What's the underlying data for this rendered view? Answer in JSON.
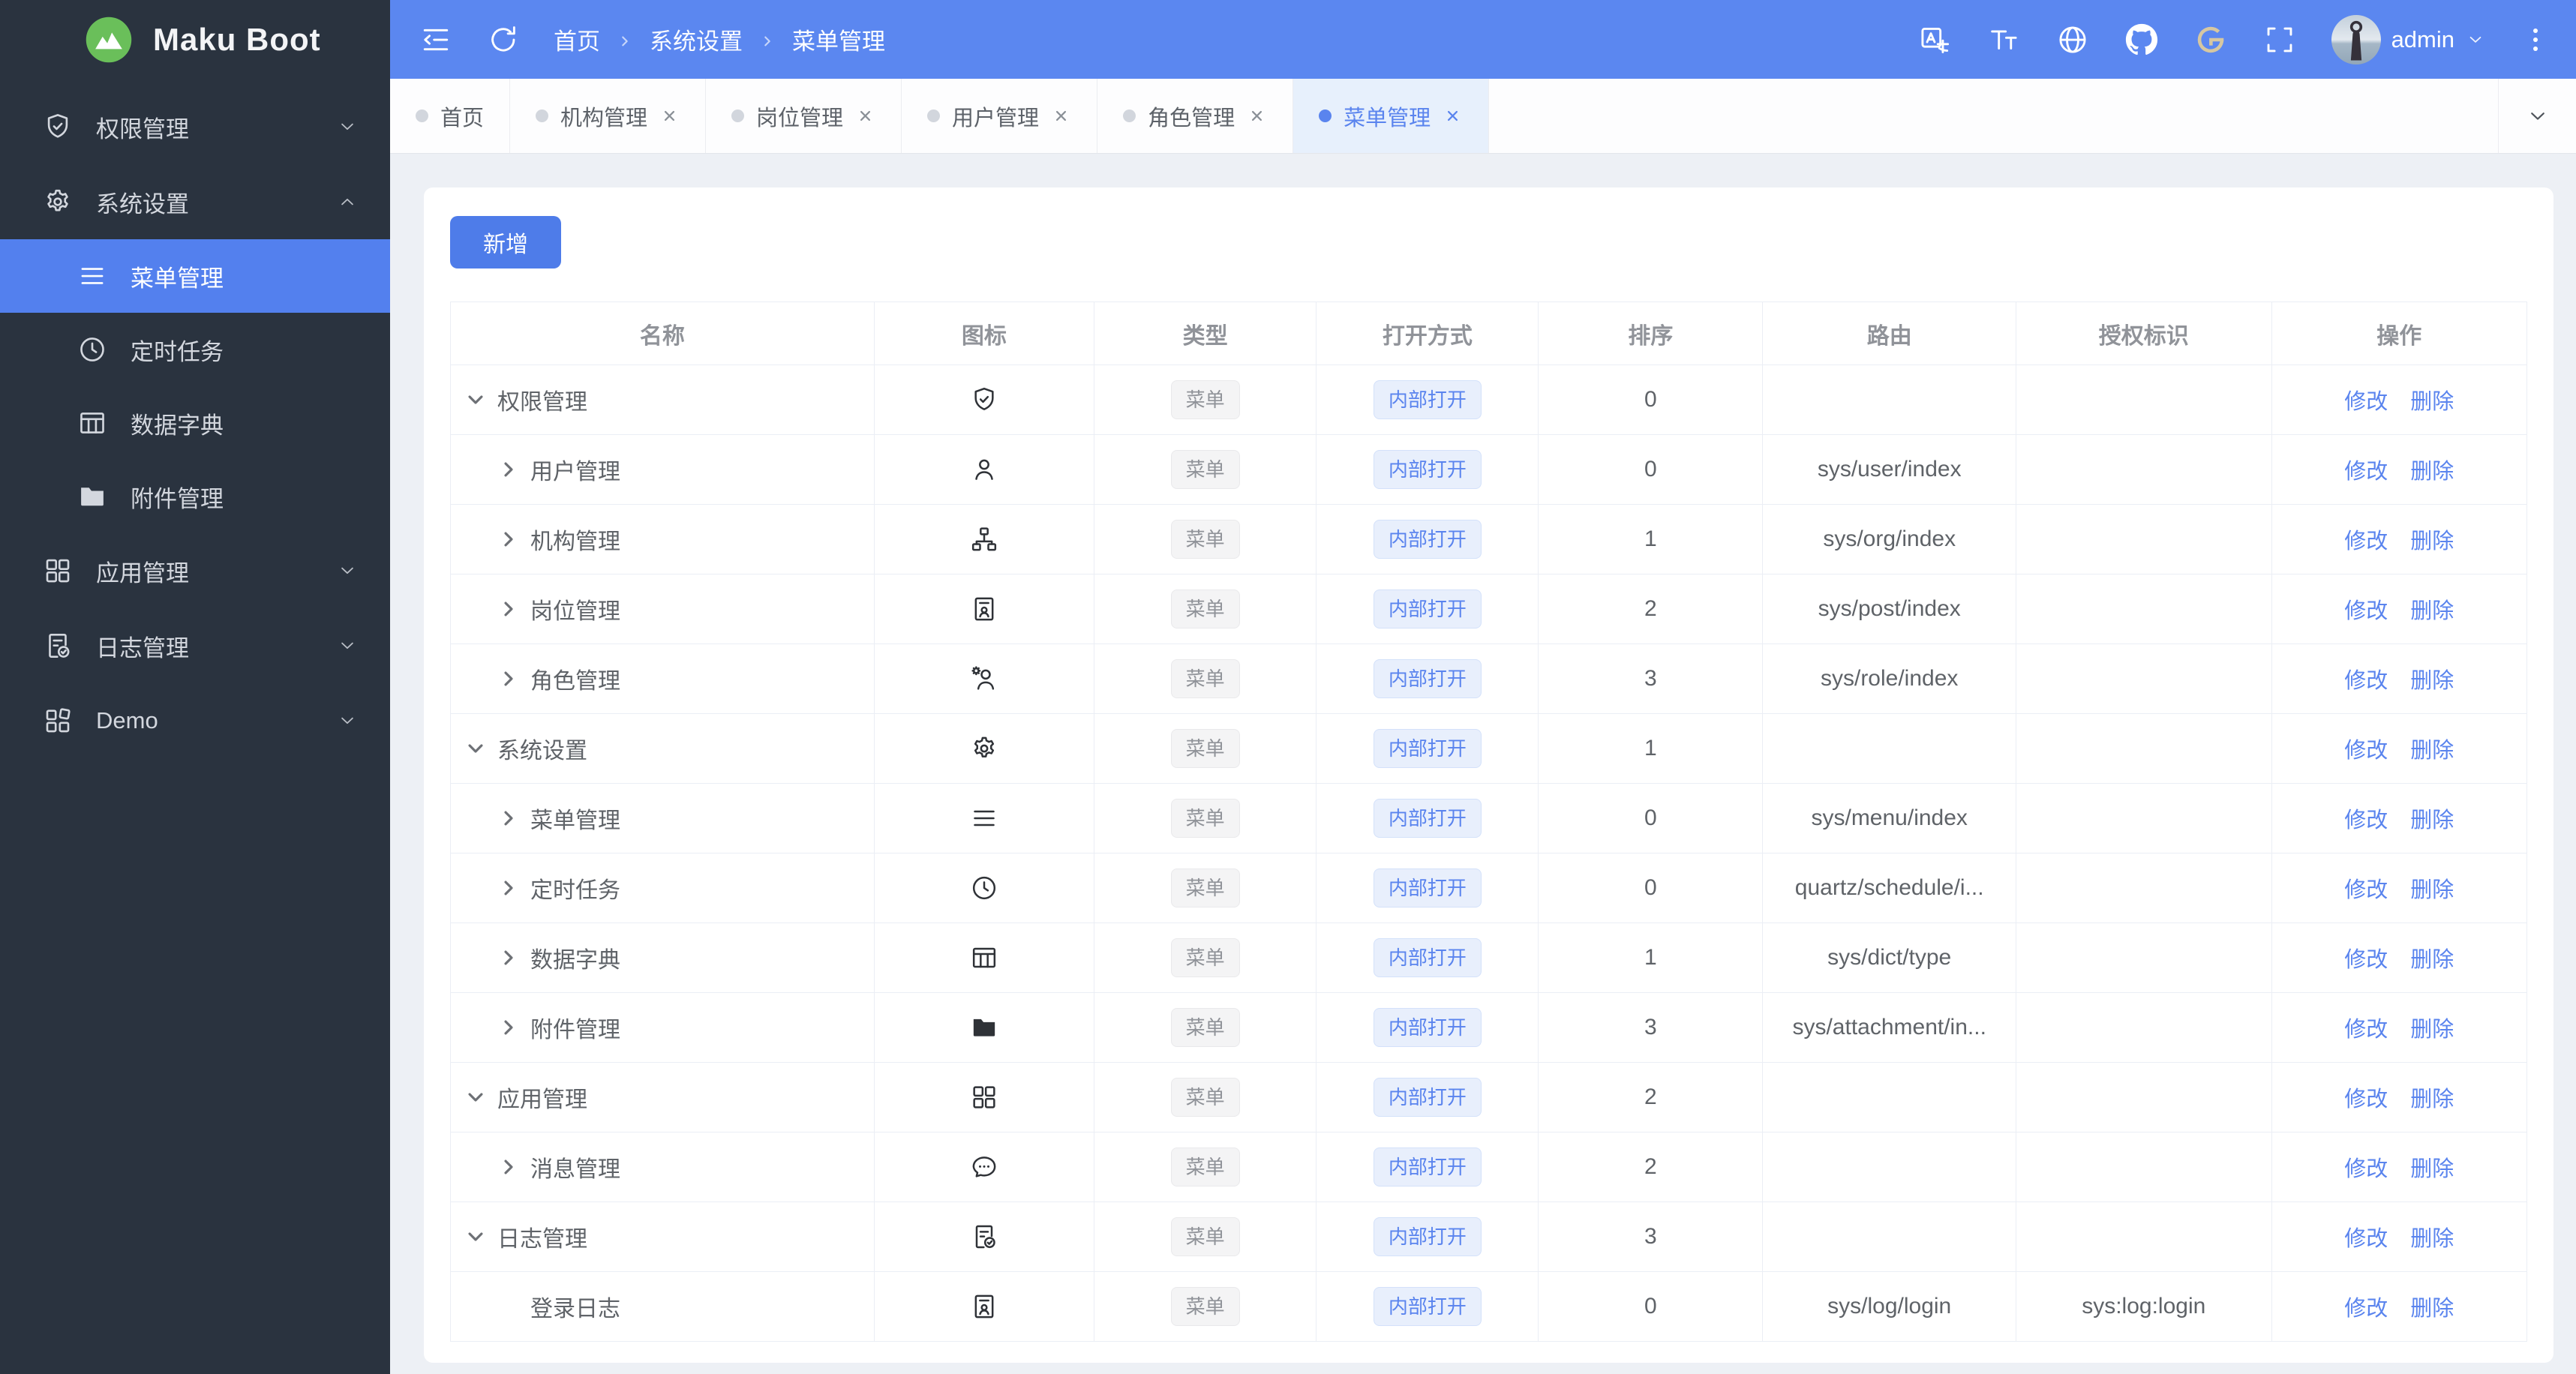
{
  "brand": {
    "name": "Maku Boot"
  },
  "theme": {
    "header_blue": "#5b87f0",
    "primary_blue": "#5a84ee",
    "button_blue": "#4e7ce9",
    "active_item_bg": "#5380ee",
    "sidebar_bg": "#2a333f",
    "content_bg": "#edf0f5",
    "logo_green": "#6abf5a",
    "gitee_gold": "#d6c7a1"
  },
  "sidebar": {
    "items": [
      {
        "key": "permission",
        "label": "权限管理",
        "icon": "shield-check",
        "chevron": "down",
        "active": false
      },
      {
        "key": "system",
        "label": "系统设置",
        "icon": "gear",
        "chevron": "up",
        "expanded": true,
        "active": false,
        "children": [
          {
            "key": "menu",
            "label": "菜单管理",
            "icon": "menu",
            "active": true
          },
          {
            "key": "schedule",
            "label": "定时任务",
            "icon": "clock",
            "active": false
          },
          {
            "key": "dict",
            "label": "数据字典",
            "icon": "table",
            "active": false
          },
          {
            "key": "attachment",
            "label": "附件管理",
            "icon": "folder",
            "active": false
          }
        ]
      },
      {
        "key": "app",
        "label": "应用管理",
        "icon": "grid",
        "chevron": "down",
        "active": false
      },
      {
        "key": "log",
        "label": "日志管理",
        "icon": "doc-check",
        "chevron": "down",
        "active": false
      },
      {
        "key": "demo",
        "label": "Demo",
        "icon": "grid-alt",
        "chevron": "down",
        "active": false
      }
    ]
  },
  "header": {
    "left_icons": [
      {
        "key": "collapse-sidebar",
        "icon": "collapse"
      },
      {
        "key": "refresh",
        "icon": "refresh"
      }
    ],
    "breadcrumb": [
      "首页",
      "系统设置",
      "菜单管理"
    ],
    "right_icons": [
      {
        "key": "translate",
        "icon": "translate"
      },
      {
        "key": "font-size",
        "icon": "font-size"
      },
      {
        "key": "globe",
        "icon": "globe"
      },
      {
        "key": "github",
        "icon": "github"
      },
      {
        "key": "gitee",
        "icon": "gitee"
      },
      {
        "key": "fullscreen",
        "icon": "fullscreen"
      }
    ],
    "user": {
      "name": "admin"
    }
  },
  "tabs": [
    {
      "key": "home",
      "label": "首页",
      "closable": false,
      "active": false
    },
    {
      "key": "org",
      "label": "机构管理",
      "closable": true,
      "active": false
    },
    {
      "key": "post",
      "label": "岗位管理",
      "closable": true,
      "active": false
    },
    {
      "key": "user",
      "label": "用户管理",
      "closable": true,
      "active": false
    },
    {
      "key": "role",
      "label": "角色管理",
      "closable": true,
      "active": false
    },
    {
      "key": "menu",
      "label": "菜单管理",
      "closable": true,
      "active": true
    }
  ],
  "toolbar": {
    "add_label": "新增"
  },
  "table": {
    "columns": [
      "名称",
      "图标",
      "类型",
      "打开方式",
      "排序",
      "路由",
      "授权标识",
      "操作"
    ],
    "action_labels": [
      "修改",
      "删除"
    ],
    "rows": [
      {
        "name": "权限管理",
        "icon": "shield-check",
        "level": 0,
        "expand": "open",
        "type": "菜单",
        "open_mode": "内部打开",
        "sort": "0",
        "route": "",
        "auth": ""
      },
      {
        "name": "用户管理",
        "icon": "user",
        "level": 1,
        "expand": "closed",
        "type": "菜单",
        "open_mode": "内部打开",
        "sort": "0",
        "route": "sys/user/index",
        "auth": ""
      },
      {
        "name": "机构管理",
        "icon": "sitemap",
        "level": 1,
        "expand": "closed",
        "type": "菜单",
        "open_mode": "内部打开",
        "sort": "1",
        "route": "sys/org/index",
        "auth": ""
      },
      {
        "name": "岗位管理",
        "icon": "id-badge",
        "level": 1,
        "expand": "closed",
        "type": "菜单",
        "open_mode": "内部打开",
        "sort": "2",
        "route": "sys/post/index",
        "auth": ""
      },
      {
        "name": "角色管理",
        "icon": "user-gear",
        "level": 1,
        "expand": "closed",
        "type": "菜单",
        "open_mode": "内部打开",
        "sort": "3",
        "route": "sys/role/index",
        "auth": ""
      },
      {
        "name": "系统设置",
        "icon": "gear",
        "level": 0,
        "expand": "open",
        "type": "菜单",
        "open_mode": "内部打开",
        "sort": "1",
        "route": "",
        "auth": ""
      },
      {
        "name": "菜单管理",
        "icon": "menu",
        "level": 1,
        "expand": "closed",
        "type": "菜单",
        "open_mode": "内部打开",
        "sort": "0",
        "route": "sys/menu/index",
        "auth": ""
      },
      {
        "name": "定时任务",
        "icon": "clock",
        "level": 1,
        "expand": "closed",
        "type": "菜单",
        "open_mode": "内部打开",
        "sort": "0",
        "route": "quartz/schedule/i...",
        "auth": ""
      },
      {
        "name": "数据字典",
        "icon": "table",
        "level": 1,
        "expand": "closed",
        "type": "菜单",
        "open_mode": "内部打开",
        "sort": "1",
        "route": "sys/dict/type",
        "auth": ""
      },
      {
        "name": "附件管理",
        "icon": "folder",
        "level": 1,
        "expand": "closed",
        "type": "菜单",
        "open_mode": "内部打开",
        "sort": "3",
        "route": "sys/attachment/in...",
        "auth": ""
      },
      {
        "name": "应用管理",
        "icon": "grid",
        "level": 0,
        "expand": "open",
        "type": "菜单",
        "open_mode": "内部打开",
        "sort": "2",
        "route": "",
        "auth": ""
      },
      {
        "name": "消息管理",
        "icon": "chat",
        "level": 1,
        "expand": "closed",
        "type": "菜单",
        "open_mode": "内部打开",
        "sort": "2",
        "route": "",
        "auth": ""
      },
      {
        "name": "日志管理",
        "icon": "doc-check",
        "level": 0,
        "expand": "open",
        "type": "菜单",
        "open_mode": "内部打开",
        "sort": "3",
        "route": "",
        "auth": ""
      },
      {
        "name": "登录日志",
        "icon": "id-badge",
        "level": 1,
        "expand": "none",
        "type": "菜单",
        "open_mode": "内部打开",
        "sort": "0",
        "route": "sys/log/login",
        "auth": "sys:log:login"
      }
    ]
  }
}
